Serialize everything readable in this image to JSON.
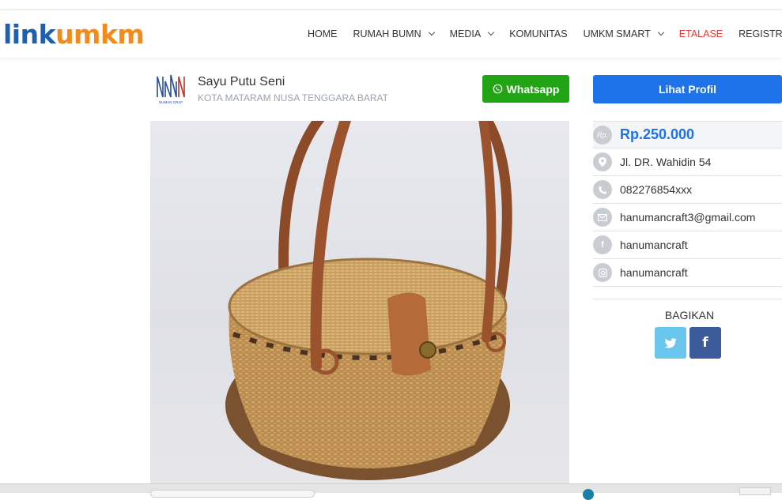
{
  "brand": {
    "part1": "link",
    "part2": "umkm"
  },
  "nav": {
    "items": [
      {
        "label": "HOME",
        "has_dropdown": false
      },
      {
        "label": "RUMAH BUMN",
        "has_dropdown": true
      },
      {
        "label": "MEDIA",
        "has_dropdown": true
      },
      {
        "label": "KOMUNITAS",
        "has_dropdown": false
      },
      {
        "label": "UMKM SMART",
        "has_dropdown": true
      },
      {
        "label": "ETALASE",
        "has_dropdown": false,
        "color": "#e53935"
      },
      {
        "label": "REGISTRASI N",
        "has_dropdown": false
      }
    ]
  },
  "seller": {
    "name": "Sayu Putu Seni",
    "location": "KOTA MATARAM NUSA TENGGARA BARAT",
    "logo_caption": "NUMAN CRAF"
  },
  "buttons": {
    "whatsapp": "Whatsapp",
    "profile": "Lihat Profil"
  },
  "product": {
    "price_icon": "Rp.",
    "price": "Rp.250.000",
    "details": [
      {
        "icon": "map-pin-icon",
        "text": "Jl. DR. Wahidin 54"
      },
      {
        "icon": "phone-icon",
        "text": "082276854xxx"
      },
      {
        "icon": "envelope-icon",
        "text": "hanumancraft3@gmail.com"
      },
      {
        "icon": "facebook-icon",
        "text": "hanumancraft"
      },
      {
        "icon": "instagram-icon",
        "text": "hanumancraft"
      }
    ]
  },
  "share": {
    "label": "BAGIKAN"
  },
  "colors": {
    "brand_blue": "#1f5fae",
    "brand_orange": "#f28a1c",
    "whatsapp_green": "#21a515",
    "primary_blue": "#1e73e8",
    "twitter": "#6bc6ee",
    "facebook": "#3b5b9a",
    "nav_active": "#e53935"
  }
}
